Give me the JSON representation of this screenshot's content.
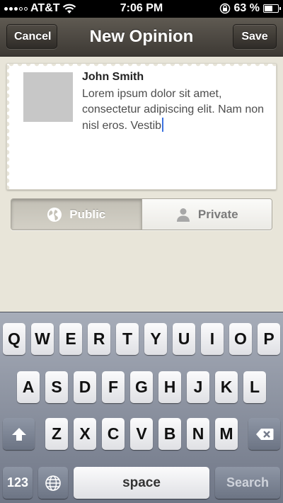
{
  "status_bar": {
    "carrier": "AT&T",
    "time": "7:06 PM",
    "battery_percent": "63 %",
    "battery_level": 0.63
  },
  "nav": {
    "title": "New Opinion",
    "cancel_label": "Cancel",
    "save_label": "Save"
  },
  "post": {
    "author": "John Smith",
    "text": "Lorem ipsum dolor sit amet, consectetur adipiscing elit. Nam non nisl eros. Vestib"
  },
  "visibility": {
    "public_label": "Public",
    "private_label": "Private",
    "selected": "Public"
  },
  "keyboard": {
    "row1": [
      "Q",
      "W",
      "E",
      "R",
      "T",
      "Y",
      "U",
      "I",
      "O",
      "P"
    ],
    "row2": [
      "A",
      "S",
      "D",
      "F",
      "G",
      "H",
      "J",
      "K",
      "L"
    ],
    "row3": [
      "Z",
      "X",
      "C",
      "V",
      "B",
      "N",
      "M"
    ],
    "numbers_label": "123",
    "space_label": "space",
    "search_label": "Search"
  }
}
